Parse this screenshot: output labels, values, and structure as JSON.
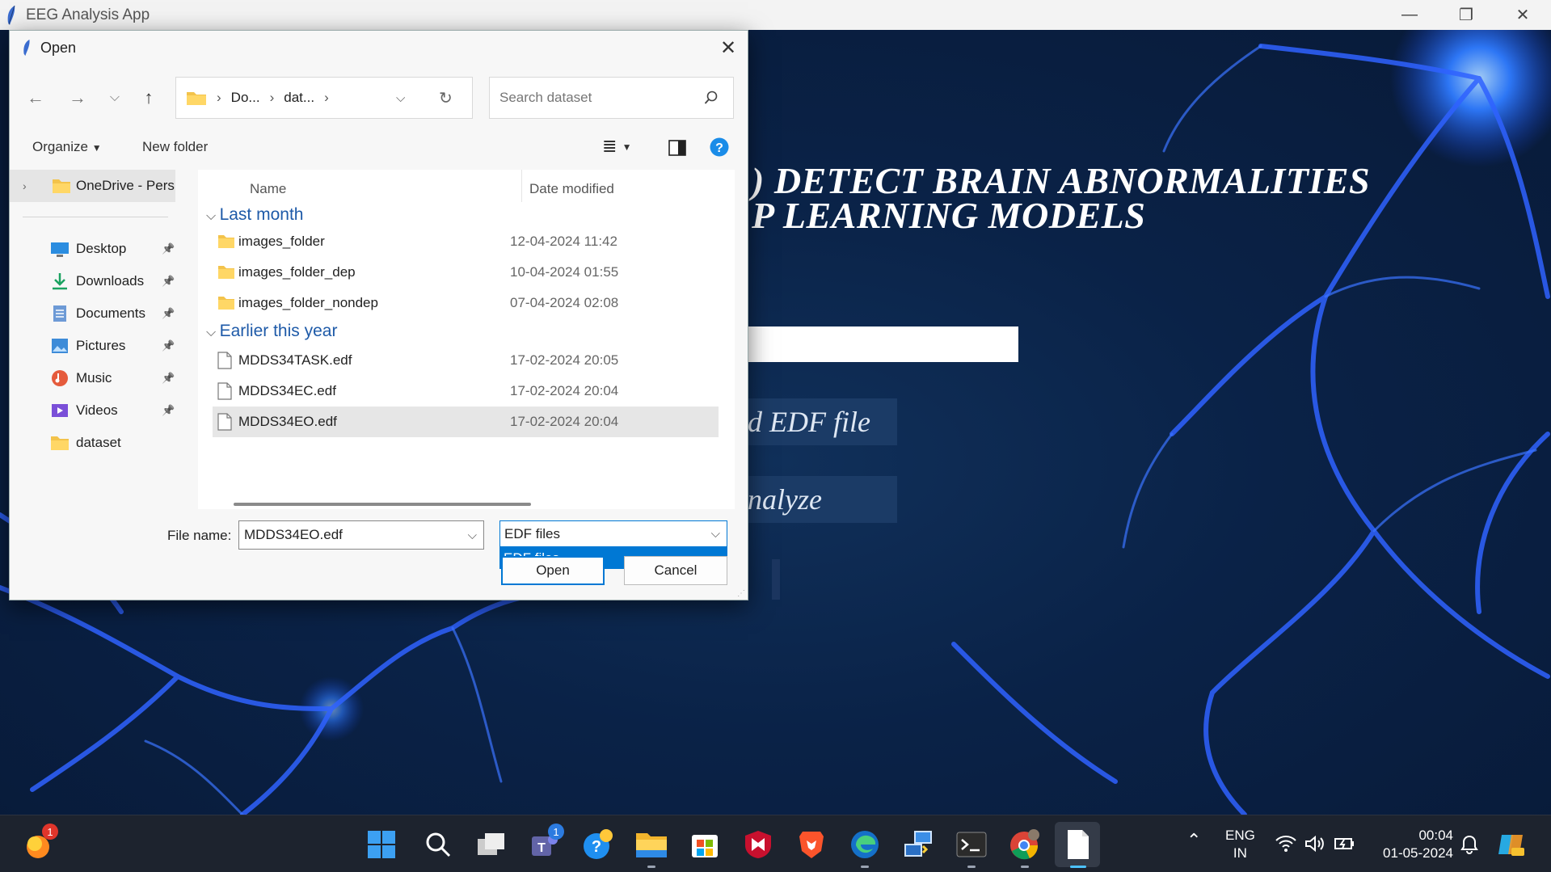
{
  "app": {
    "title": "EEG Analysis App",
    "headline_line1": "DETECT BRAIN ABNORMALITIES",
    "headline_line2": "LEARNING MODELS",
    "headline_prefix1": ")",
    "headline_prefix2": "P",
    "load_button": "d EDF file",
    "analyze_button": "nalyze"
  },
  "window_controls": {
    "minimize": "—",
    "restore": "❐",
    "close": "✕"
  },
  "dialog": {
    "title": "Open",
    "close": "✕",
    "address": {
      "segment1": "Do...",
      "segment2": "dat..."
    },
    "search_placeholder": "Search dataset",
    "toolbar": {
      "organize": "Organize",
      "new_folder": "New folder"
    },
    "sidebar": {
      "onedrive": "OneDrive - Pers",
      "items": [
        {
          "label": "Desktop",
          "icon": "desktop-icon",
          "pinned": true
        },
        {
          "label": "Downloads",
          "icon": "downloads-icon",
          "pinned": true
        },
        {
          "label": "Documents",
          "icon": "documents-icon",
          "pinned": true
        },
        {
          "label": "Pictures",
          "icon": "pictures-icon",
          "pinned": true
        },
        {
          "label": "Music",
          "icon": "music-icon",
          "pinned": true
        },
        {
          "label": "Videos",
          "icon": "videos-icon",
          "pinned": true
        },
        {
          "label": "dataset",
          "icon": "folder-icon",
          "pinned": false
        }
      ]
    },
    "columns": {
      "name": "Name",
      "date": "Date modified"
    },
    "groups": [
      {
        "label": "Last month",
        "files": [
          {
            "name": "images_folder",
            "date": "12-04-2024 11:42",
            "type": "folder"
          },
          {
            "name": "images_folder_dep",
            "date": "10-04-2024 01:55",
            "type": "folder"
          },
          {
            "name": "images_folder_nondep",
            "date": "07-04-2024 02:08",
            "type": "folder"
          }
        ]
      },
      {
        "label": "Earlier this year",
        "files": [
          {
            "name": "MDDS34TASK.edf",
            "date": "17-02-2024 20:05",
            "type": "file"
          },
          {
            "name": "MDDS34EC.edf",
            "date": "17-02-2024 20:04",
            "type": "file"
          },
          {
            "name": "MDDS34EO.edf",
            "date": "17-02-2024 20:04",
            "type": "file",
            "selected": true
          }
        ]
      }
    ],
    "file_name_label": "File name:",
    "file_name_value": "MDDS34EO.edf",
    "file_type_value": "EDF files",
    "file_type_option": "EDF files",
    "open_button": "Open",
    "cancel_button": "Cancel"
  },
  "taskbar": {
    "notification_badge": "1",
    "teams_badge": "1",
    "lang_line1": "ENG",
    "lang_line2": "IN",
    "time": "00:04",
    "date": "01-05-2024"
  },
  "colors": {
    "accent": "#0078d4",
    "app_bg": "#0a2247",
    "neuron": "#2f6bff"
  }
}
